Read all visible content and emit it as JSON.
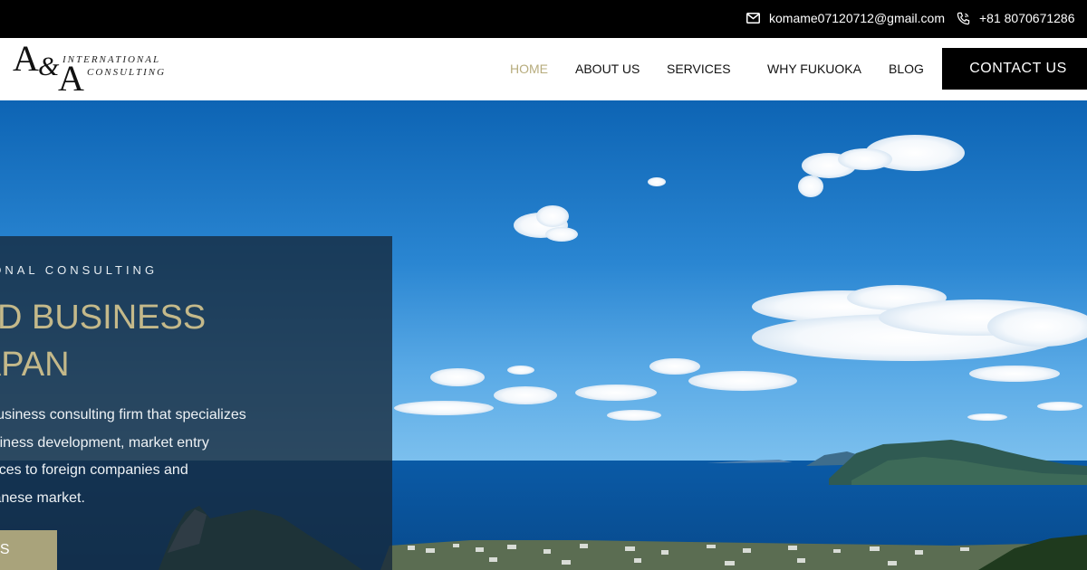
{
  "topbar": {
    "email": "komame07120712@gmail.com",
    "phone": "+81 8070671286",
    "email_icon": "envelope-icon",
    "phone_icon": "phone-icon"
  },
  "logo": {
    "mark": "A&A",
    "line1": "INTERNATIONAL",
    "line2": "CONSULTING"
  },
  "nav": {
    "items": [
      {
        "label": "HOME",
        "active": true
      },
      {
        "label": "ABOUT US",
        "active": false
      },
      {
        "label": "SERVICES",
        "active": false
      },
      {
        "label": "WHY FUKUOKA",
        "active": false
      },
      {
        "label": "BLOG",
        "active": false
      }
    ],
    "cta_label": "CONTACT US"
  },
  "hero": {
    "eyebrow": "ATIONAL CONSULTING",
    "headline_line1": "TRUSTED BUSINESS",
    "headline_line2": "ER IN JAPAN",
    "desc_line1": "e Japanese business consulting firm that specializes",
    "desc_line2": "rehensive business development, market entry",
    "desc_line3": "sourcing services to foreign companies and",
    "desc_line4": "ering the Japanese market.",
    "button_label": "T US"
  },
  "colors": {
    "accent_gold": "#b7ac7d",
    "button_olive": "#a9a37b",
    "topbar_bg": "#000000",
    "overlay_bg": "#16283a"
  }
}
